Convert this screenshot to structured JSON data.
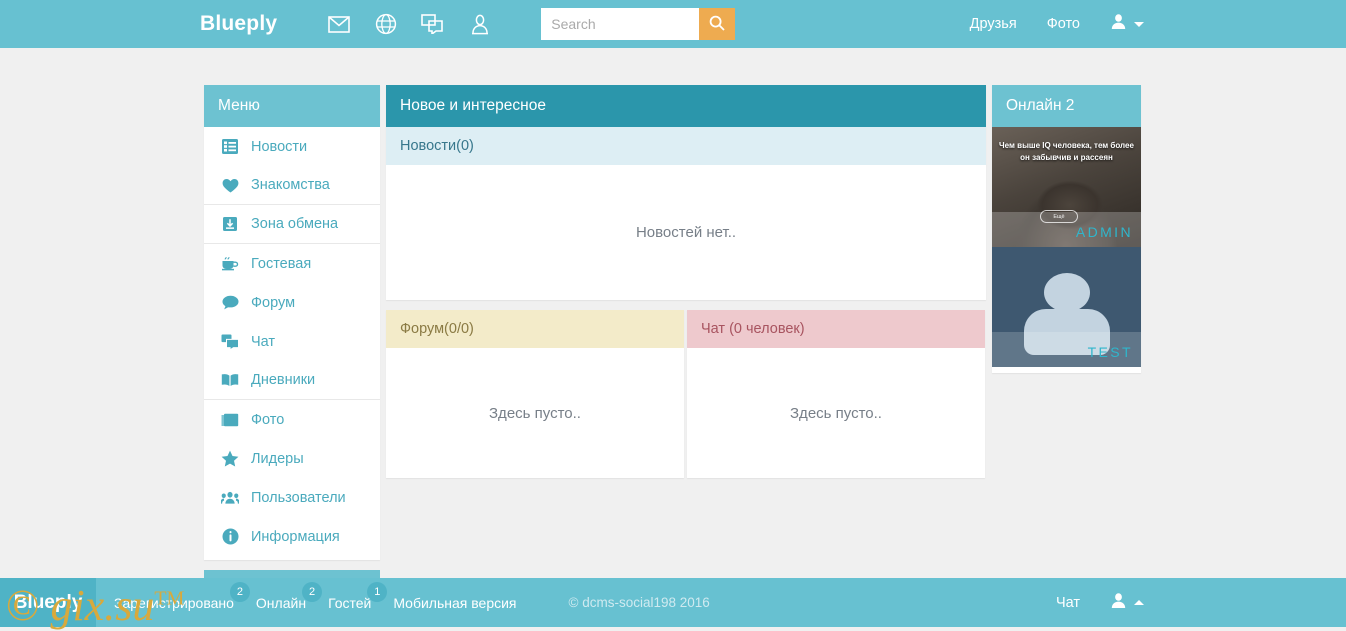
{
  "header": {
    "brand": "Blueply",
    "icons": [
      {
        "name": "mail-icon"
      },
      {
        "name": "globe-icon"
      },
      {
        "name": "chat-bubbles-icon"
      },
      {
        "name": "user-outline-icon"
      }
    ],
    "search": {
      "value": "",
      "placeholder": "Search",
      "button_icon": "search-icon"
    },
    "links": [
      "Друзья",
      "Фото"
    ],
    "user_menu_icon": "user-icon"
  },
  "sidebar": {
    "title": "Меню",
    "items": [
      {
        "label": "Новости",
        "icon": "list-icon"
      },
      {
        "label": "Знакомства",
        "icon": "heart-icon"
      },
      {
        "label": "Зона обмена",
        "icon": "download-box-icon"
      },
      {
        "label": "Гостевая",
        "icon": "coffee-icon"
      },
      {
        "label": "Форум",
        "icon": "comment-icon"
      },
      {
        "label": "Чат",
        "icon": "chat-bubbles-icon"
      },
      {
        "label": "Дневники",
        "icon": "book-icon"
      },
      {
        "label": "Фото",
        "icon": "photos-icon"
      },
      {
        "label": "Лидеры",
        "icon": "star-icon"
      },
      {
        "label": "Пользователи",
        "icon": "users-icon"
      },
      {
        "label": "Информация",
        "icon": "info-icon"
      }
    ]
  },
  "main": {
    "title": "Новое и интересное",
    "news": {
      "subhead": "Новости(0)",
      "empty": "Новостей нет.."
    },
    "forum": {
      "head": "Форум(0/0)",
      "empty": "Здесь пусто.."
    },
    "chat": {
      "head": "Чат (0 человек)",
      "empty": "Здесь пусто.."
    }
  },
  "online": {
    "title": "Онлайн 2",
    "users": [
      {
        "name": "ADMIN",
        "quote": "Чем выше IQ человека, тем более он забывчив и рассеян",
        "more_label": "Ещё"
      },
      {
        "name": "TEST"
      }
    ]
  },
  "footer": {
    "brand": "Blueply",
    "links": [
      {
        "label": "Зарегистрировано",
        "badge": "2"
      },
      {
        "label": "Онлайн",
        "badge": "2"
      },
      {
        "label": "Гостей",
        "badge": "1"
      },
      {
        "label": "Мобильная версия",
        "badge": ""
      }
    ],
    "copyright": "© dcms-social198 2016",
    "chat_link": "Чат",
    "user_menu_icon": "user-icon"
  },
  "watermark": {
    "c": "©",
    "text": "gix.su",
    "tm": "TM"
  },
  "colors": {
    "brand_light": "#67c1d1",
    "brand_dark": "#2b96ab",
    "accent_orange": "#eeab50",
    "page_bg": "#f0f0f0",
    "link_teal": "#4aaabd"
  }
}
